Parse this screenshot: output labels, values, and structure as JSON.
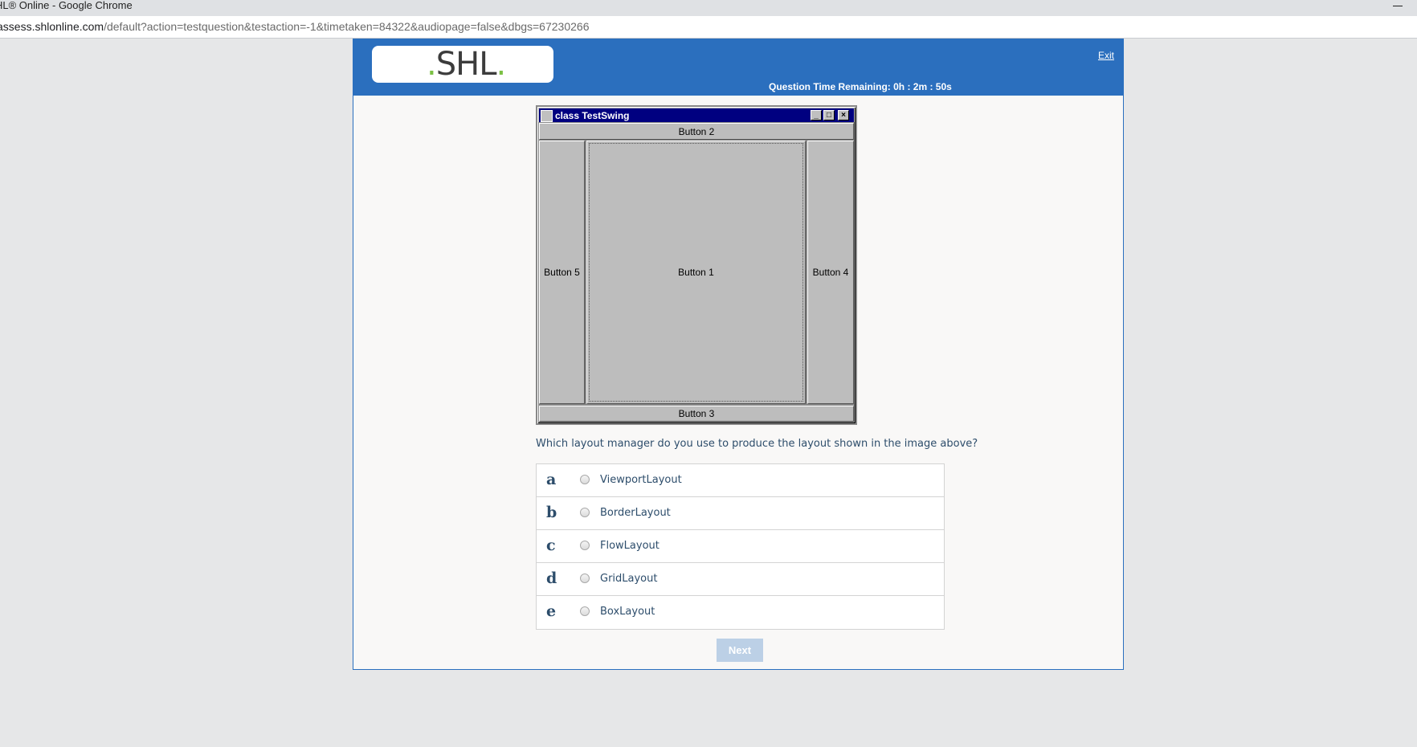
{
  "browser": {
    "window_title": "HL® Online - Google Chrome",
    "url_host": "assess.shlonline.com",
    "url_rest": "/default?action=testquestion&testaction=-1&timetaken=84322&audiopage=false&dbgs=67230266"
  },
  "header": {
    "logo_left_dot": ".",
    "logo_text": "SHL",
    "logo_right_dot": ".",
    "exit_label": "Exit",
    "timer_text": "Question Time Remaining: 0h : 2m : 50s"
  },
  "swing_window": {
    "title": "class TestSwing",
    "buttons": {
      "north": "Button 2",
      "west": "Button 5",
      "center": "Button 1",
      "east": "Button 4",
      "south": "Button 3"
    }
  },
  "question": {
    "text": "Which layout manager do you use to produce the layout shown in the image above?",
    "options": [
      {
        "letter": "a",
        "label": "ViewportLayout"
      },
      {
        "letter": "b",
        "label": "BorderLayout"
      },
      {
        "letter": "c",
        "label": "FlowLayout"
      },
      {
        "letter": "d",
        "label": "GridLayout"
      },
      {
        "letter": "e",
        "label": "BoxLayout"
      }
    ]
  },
  "footer": {
    "next_label": "Next"
  },
  "colors": {
    "header_blue": "#2b6fbe",
    "logo_green": "#7bc043",
    "text_navy": "#2d4d6b",
    "next_disabled": "#bcd0e6"
  }
}
